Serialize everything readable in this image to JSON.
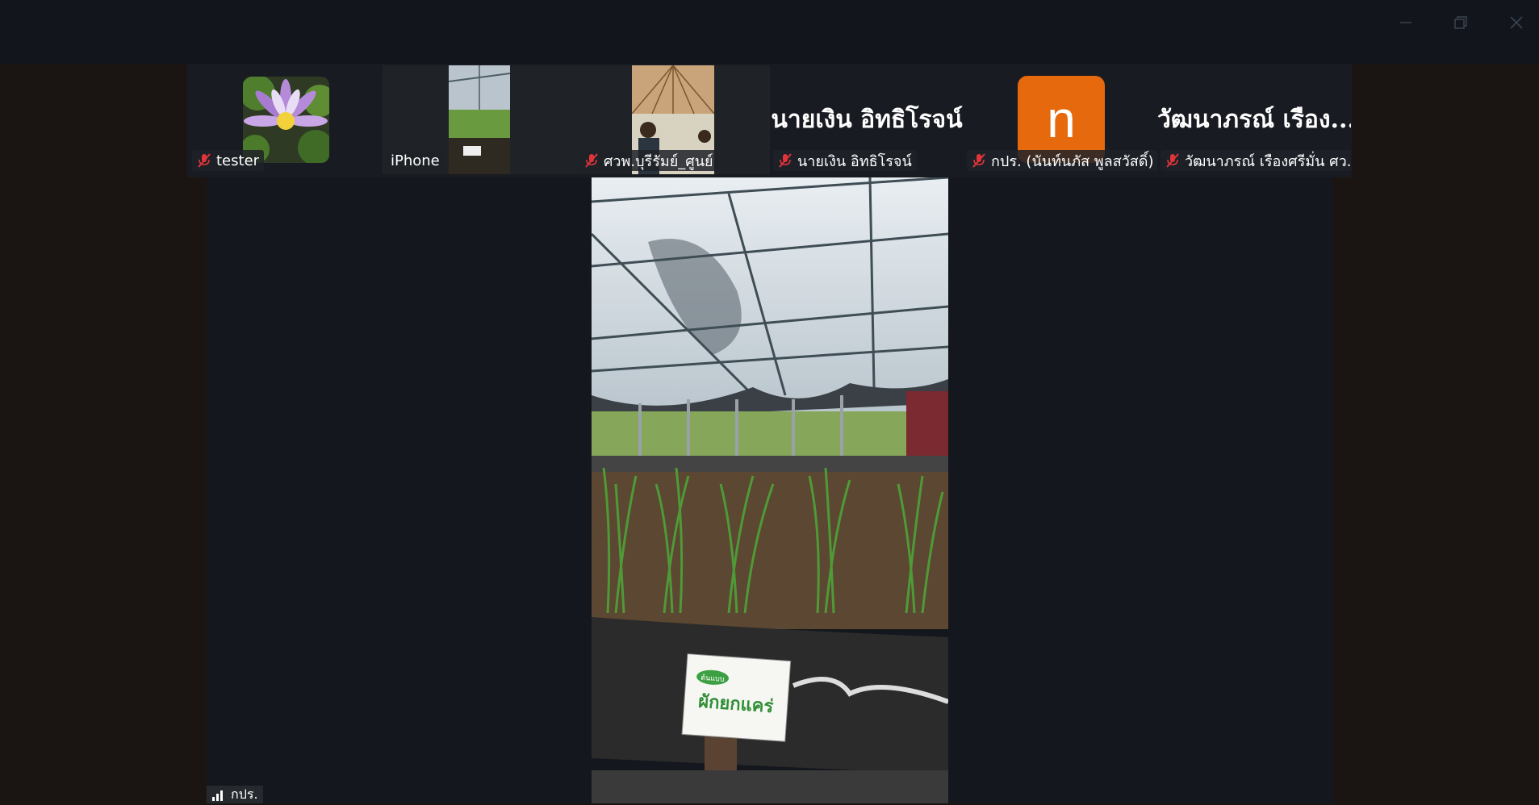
{
  "window": {
    "minimize_label": "minimize",
    "restore_label": "restore",
    "close_label": "close"
  },
  "participants": [
    {
      "name": "tester",
      "muted": true,
      "avatar": "water-lily-photo"
    },
    {
      "name": "iPhone",
      "muted": false,
      "avatar": "greenhouse-video"
    },
    {
      "name": "ศวพ.บุรีรัมย์_ศูนย์",
      "muted": true,
      "avatar": "pavilion-video"
    },
    {
      "name": "นายเงิน  อิทธิโรจน์",
      "display_name": "นายเงิน  อิทธิโรจน์",
      "muted": true
    },
    {
      "name": "กปร. (นันท์นภัส พูลสวัสดิ์)",
      "avatar_letter": "n",
      "avatar_color": "#e7690e",
      "muted": true
    },
    {
      "name": "วัฒนาภรณ์  เรืองศรีมั่น ศว...",
      "display_name": "วัฒนาภรณ์  เรือง...",
      "muted": true
    }
  ],
  "active_speaker": {
    "label": "กปร.",
    "sign_text": "ผักยกแคร่",
    "sign_badge": "ต้นแบบ"
  }
}
